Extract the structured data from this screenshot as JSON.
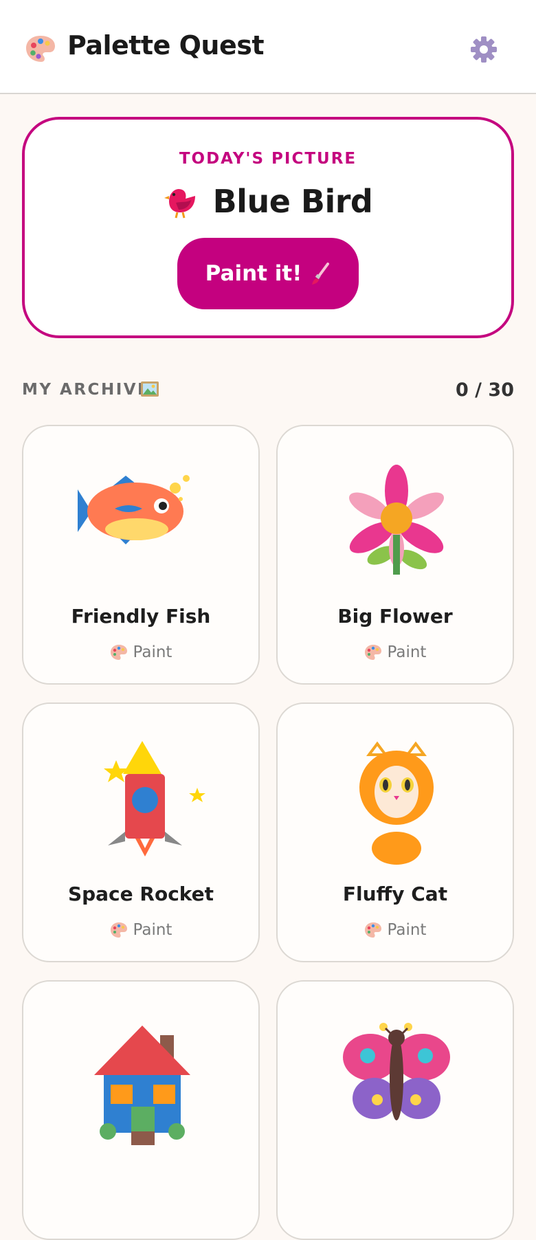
{
  "app": {
    "title": "Palette Quest",
    "logo_icon": "palette-icon",
    "settings_icon": "gear-icon"
  },
  "today": {
    "label": "TODAY'S PICTURE",
    "title": "Blue Bird",
    "title_icon": "bird-icon",
    "button_label": "Paint it!",
    "button_icon": "paintbrush-icon",
    "accent": "#c4067f"
  },
  "archive": {
    "label": "MY ARCHIVE",
    "label_icon": "framed-picture-icon",
    "count": "0 / 30",
    "items": [
      {
        "title": "Friendly Fish",
        "action": "Paint",
        "art": "fish-icon"
      },
      {
        "title": "Big Flower",
        "action": "Paint",
        "art": "flower-icon"
      },
      {
        "title": "Space Rocket",
        "action": "Paint",
        "art": "rocket-icon"
      },
      {
        "title": "Fluffy Cat",
        "action": "Paint",
        "art": "cat-icon"
      },
      {
        "title": "",
        "action": "",
        "art": "house-icon"
      },
      {
        "title": "",
        "action": "",
        "art": "butterfly-icon"
      }
    ]
  }
}
